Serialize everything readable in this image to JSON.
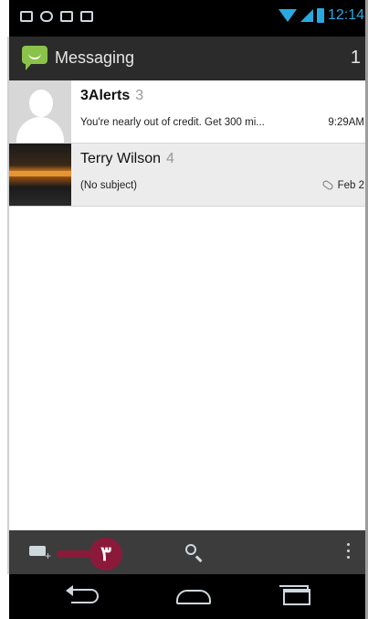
{
  "status_bar": {
    "time": "12:14"
  },
  "action_bar": {
    "title": "Messaging",
    "unread": "1"
  },
  "conversations": [
    {
      "name": "3Alerts",
      "count": "3",
      "snippet": "You're nearly out of credit. Get 300 mi...",
      "time": "9:29AM"
    },
    {
      "name": "Terry Wilson",
      "count": "4",
      "snippet": "(No subject)",
      "time": "Feb 2"
    }
  ],
  "bottom_bar": {
    "badge": "٣"
  }
}
